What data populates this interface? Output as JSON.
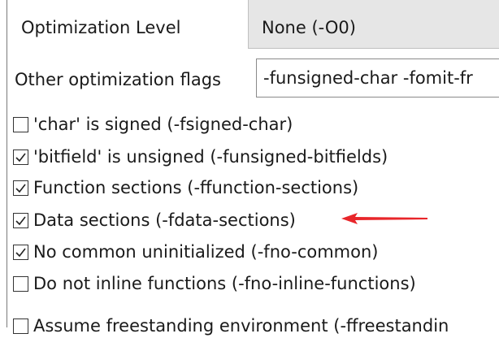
{
  "optimization": {
    "label": "Optimization Level",
    "value": "None (-O0)"
  },
  "other_flags": {
    "label": "Other optimization flags",
    "value": "-funsigned-char -fomit-fr"
  },
  "checkboxes": [
    {
      "label": "'char' is signed (-fsigned-char)",
      "checked": false
    },
    {
      "label": "'bitfield' is unsigned (-funsigned-bitfields)",
      "checked": true
    },
    {
      "label": "Function sections (-ffunction-sections)",
      "checked": true
    },
    {
      "label": "Data sections (-fdata-sections)",
      "checked": true
    },
    {
      "label": "No common uninitialized (-fno-common)",
      "checked": true
    },
    {
      "label": "Do not inline functions (-fno-inline-functions)",
      "checked": false
    },
    {
      "label": "Assume freestanding environment (-ffreestandin",
      "checked": false
    }
  ],
  "colors": {
    "arrow": "#e8262a"
  }
}
